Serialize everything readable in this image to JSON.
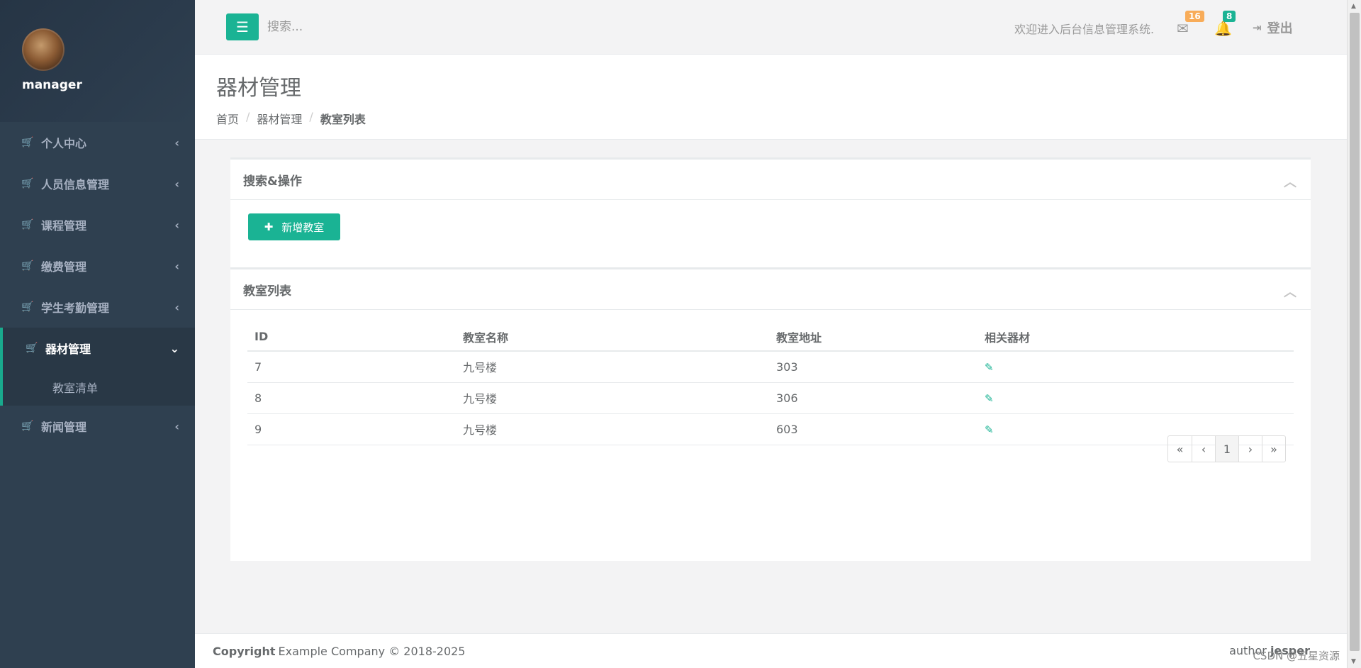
{
  "sidebar": {
    "username": "manager",
    "items": [
      {
        "label": "个人中心",
        "icon": "cart-icon",
        "arrow": "‹"
      },
      {
        "label": "人员信息管理",
        "icon": "cart-icon",
        "arrow": "‹"
      },
      {
        "label": "课程管理",
        "icon": "cart-icon",
        "arrow": "‹"
      },
      {
        "label": "缴费管理",
        "icon": "cart-icon",
        "arrow": "‹"
      },
      {
        "label": "学生考勤管理",
        "icon": "cart-icon",
        "arrow": "‹"
      },
      {
        "label": "器材管理",
        "icon": "cart-icon",
        "arrow": "⌄"
      },
      {
        "label": "新闻管理",
        "icon": "cart-icon",
        "arrow": "‹"
      }
    ],
    "sub_items": [
      "教室清单"
    ]
  },
  "topbar": {
    "search_placeholder": "搜索...",
    "welcome": "欢迎进入后台信息管理系统.",
    "mail_count": "16",
    "notification_count": "8",
    "logout_label": "登出"
  },
  "heading": {
    "title": "器材管理",
    "breadcrumb": [
      "首页",
      "器材管理",
      "教室列表"
    ]
  },
  "search_panel": {
    "title": "搜索&操作",
    "add_button": "新增教室"
  },
  "list_panel": {
    "title": "教室列表",
    "columns": [
      "ID",
      "教室名称",
      "教室地址",
      "相关器材"
    ],
    "rows": [
      [
        "7",
        "九号楼",
        "303"
      ],
      [
        "8",
        "九号楼",
        "306"
      ],
      [
        "9",
        "九号楼",
        "603"
      ]
    ],
    "pagination": [
      "«",
      "‹",
      "1",
      "›",
      "»"
    ]
  },
  "footer": {
    "copyright_label": "Copyright",
    "company": "Example Company © 2018-2025",
    "author_label": "author",
    "author": "jesper",
    "watermark": "CSDN @五星资源"
  },
  "colors": {
    "sidebar_bg": "#2f4050",
    "accent": "#19aa8d",
    "primary": "#1ab394",
    "warning": "#f8ac59"
  }
}
